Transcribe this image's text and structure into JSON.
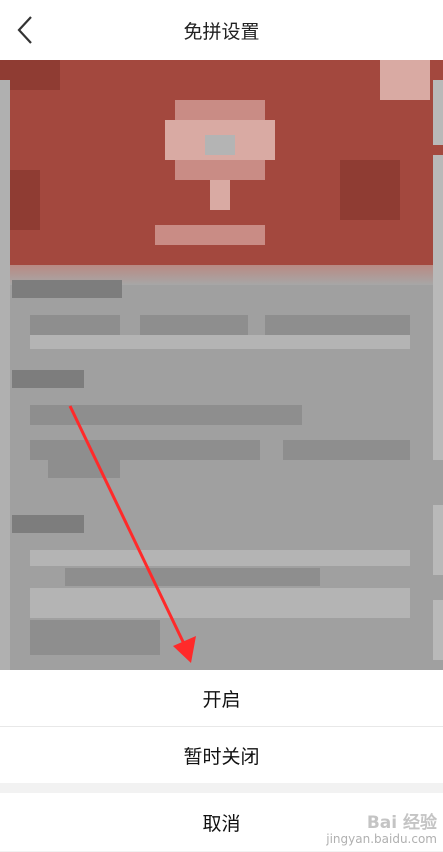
{
  "header": {
    "title": "免拼设置"
  },
  "sheet": {
    "options": [
      "开启",
      "暂时关闭"
    ],
    "cancel": "取消"
  },
  "watermark": {
    "logo": "Bai 经验",
    "url": "jingyan.baidu.com"
  },
  "colors": {
    "arrow": "#ff2a2a",
    "banner": "#a3483e",
    "overlay": "#a0a0a0"
  },
  "icons": {
    "back": "chevron-left-icon"
  }
}
